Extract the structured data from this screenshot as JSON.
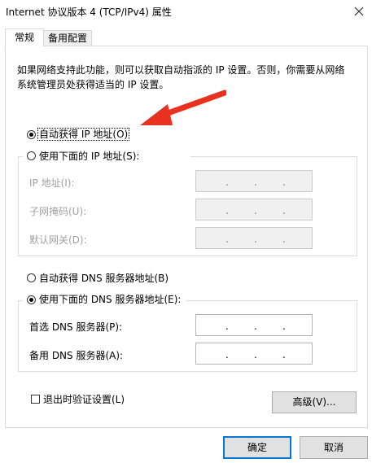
{
  "window": {
    "title": "Internet 协议版本 4 (TCP/IPv4) 属性"
  },
  "tabs": [
    {
      "label": "常规",
      "active": true
    },
    {
      "label": "备用配置",
      "active": false
    }
  ],
  "description": "如果网络支持此功能，则可以获取自动指派的 IP 设置。否则，你需要从网络系统管理员处获得适当的 IP 设置。",
  "ip": {
    "auto_label": "自动获得 IP 地址(O)",
    "auto_checked": true,
    "manual_label": "使用下面的 IP 地址(S):",
    "manual_checked": false,
    "fields": [
      {
        "label": "IP 地址(I):",
        "value": ". . ."
      },
      {
        "label": "子网掩码(U):",
        "value": ". . ."
      },
      {
        "label": "默认网关(D):",
        "value": ". . ."
      }
    ]
  },
  "dns": {
    "auto_label": "自动获得 DNS 服务器地址(B)",
    "auto_checked": false,
    "manual_label": "使用下面的 DNS 服务器地址(E):",
    "manual_checked": true,
    "fields": [
      {
        "label": "首选 DNS 服务器(P):",
        "value": ". . ."
      },
      {
        "label": "备用 DNS 服务器(A):",
        "value": ". . ."
      }
    ]
  },
  "validate": {
    "label": "退出时验证设置(L)",
    "checked": false
  },
  "buttons": {
    "advanced": "高级(V)...",
    "ok": "确定",
    "cancel": "取消"
  },
  "colors": {
    "annotation_arrow": "#e8321f",
    "focus_border": "#0078d7"
  },
  "icons": {
    "close": "close-icon",
    "annotation": "red-arrow-icon"
  }
}
